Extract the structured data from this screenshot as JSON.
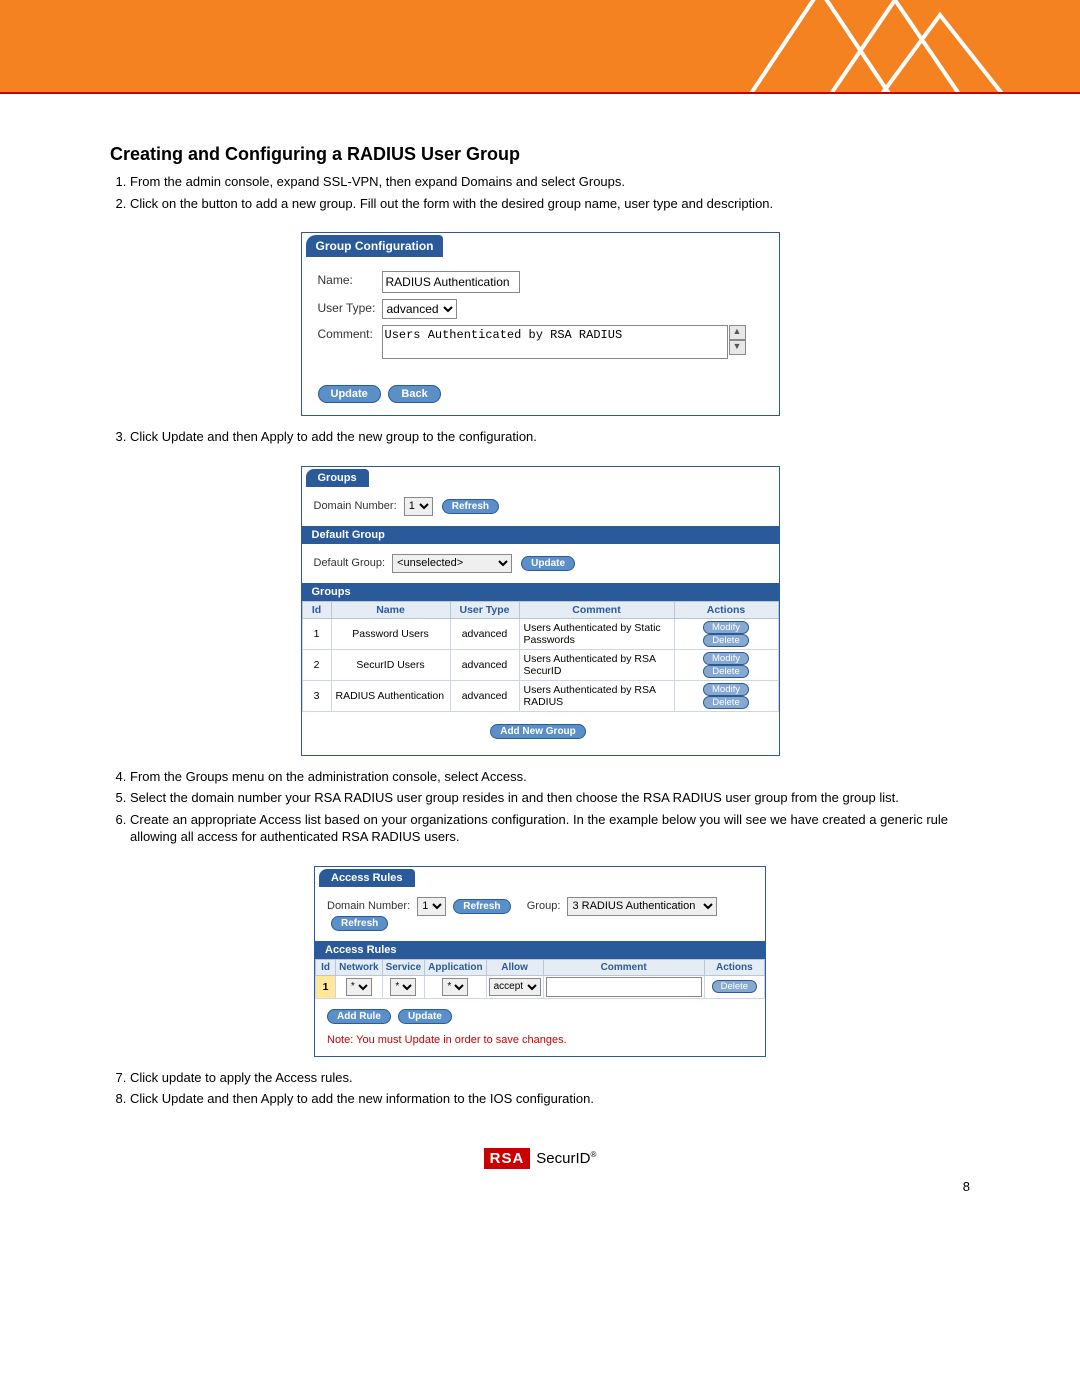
{
  "heading": "Creating and Configuring a RADIUS User Group",
  "steps_a": [
    "From the admin console, expand SSL-VPN, then expand Domains and select Groups.",
    "Click on the button to add a new group.  Fill out the form with the desired group name, user type and description."
  ],
  "group_config": {
    "title": "Group Configuration",
    "name_label": "Name:",
    "name_value": "RADIUS Authentication",
    "usertype_label": "User Type:",
    "usertype_value": "advanced",
    "comment_label": "Comment:",
    "comment_value": "Users Authenticated by RSA RADIUS",
    "update_btn": "Update",
    "back_btn": "Back"
  },
  "step3": "Click Update and then Apply to add the new group to the configuration.",
  "groups_panel": {
    "title": "Groups",
    "domain_label": "Domain Number:",
    "domain_value": "1",
    "refresh_btn": "Refresh",
    "default_group_bar": "Default Group",
    "default_group_label": "Default Group:",
    "default_group_value": "<unselected>",
    "update_btn": "Update",
    "groups_bar": "Groups",
    "headers": {
      "id": "Id",
      "name": "Name",
      "usertype": "User Type",
      "comment": "Comment",
      "actions": "Actions"
    },
    "rows": [
      {
        "id": "1",
        "name": "Password Users",
        "usertype": "advanced",
        "comment": "Users Authenticated by Static Passwords"
      },
      {
        "id": "2",
        "name": "SecurID Users",
        "usertype": "advanced",
        "comment": "Users Authenticated by RSA SecurID"
      },
      {
        "id": "3",
        "name": "RADIUS Authentication",
        "usertype": "advanced",
        "comment": "Users Authenticated by RSA RADIUS"
      }
    ],
    "modify_btn": "Modify",
    "delete_btn": "Delete",
    "add_new_btn": "Add New Group"
  },
  "steps_b": [
    "From the Groups menu on the administration console, select Access.",
    "Select the domain number your RSA RADIUS user group resides in and then choose the RSA RADIUS user group from the group list.",
    "Create an appropriate Access list based on your organizations configuration.  In the example below you will see we have created a generic rule allowing all access for authenticated RSA RADIUS users."
  ],
  "access_panel": {
    "title": "Access Rules",
    "domain_label": "Domain Number:",
    "domain_value": "1",
    "refresh_btn": "Refresh",
    "group_label": "Group:",
    "group_value": "3 RADIUS Authentication",
    "table_bar": "Access Rules",
    "headers": {
      "id": "Id",
      "network": "Network",
      "service": "Service",
      "application": "Application",
      "allow": "Allow",
      "comment": "Comment",
      "actions": "Actions"
    },
    "row": {
      "id": "1",
      "network": "*",
      "service": "*",
      "application": "*",
      "allow": "accept",
      "comment": ""
    },
    "delete_btn": "Delete",
    "add_rule_btn": "Add Rule",
    "update_btn": "Update",
    "note": "Note: You must Update in order to save changes."
  },
  "steps_c": [
    "Click update to apply the Access rules.",
    "Click Update and then Apply to add the new information to the IOS configuration."
  ],
  "footer": {
    "rsa": "RSA",
    "securid": "SecurID",
    "reg": "®",
    "pagenum": "8"
  }
}
